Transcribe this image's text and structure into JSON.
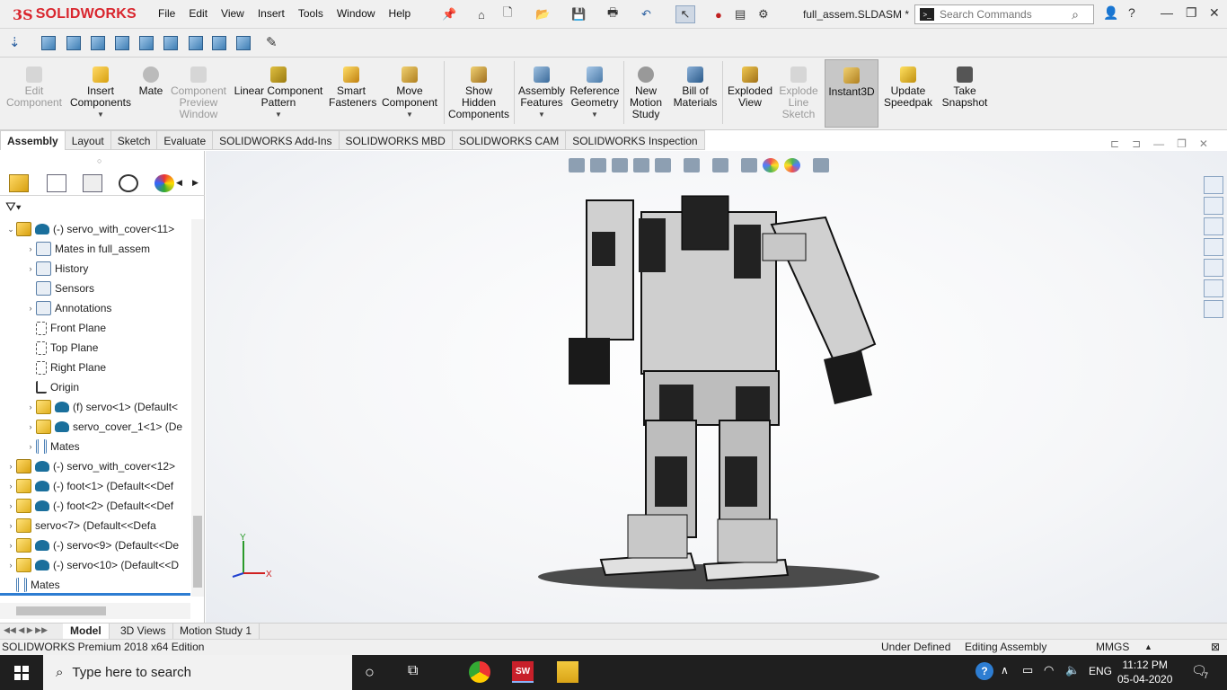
{
  "titlebar": {
    "brand": "SOLIDWORKS",
    "menu": [
      "File",
      "Edit",
      "View",
      "Insert",
      "Tools",
      "Window",
      "Help"
    ],
    "doc_title": "full_assem.SLDASM *",
    "search_placeholder": "Search Commands"
  },
  "command_manager": {
    "items": [
      {
        "label": "Edit Component",
        "enabled": false
      },
      {
        "label": "Insert Components",
        "enabled": true
      },
      {
        "label": "Mate",
        "enabled": true
      },
      {
        "label": "Component Preview Window",
        "enabled": false
      },
      {
        "label": "Linear Component Pattern",
        "enabled": true
      },
      {
        "label": "Smart Fasteners",
        "enabled": true
      },
      {
        "label": "Move Component",
        "enabled": true
      },
      {
        "label": "Show Hidden Components",
        "enabled": true
      },
      {
        "label": "Assembly Features",
        "enabled": true
      },
      {
        "label": "Reference Geometry",
        "enabled": true
      },
      {
        "label": "New Motion Study",
        "enabled": true
      },
      {
        "label": "Bill of Materials",
        "enabled": true
      },
      {
        "label": "Exploded View",
        "enabled": true
      },
      {
        "label": "Explode Line Sketch",
        "enabled": false
      },
      {
        "label": "Instant3D",
        "enabled": true,
        "active": true
      },
      {
        "label": "Update Speedpak",
        "enabled": true
      },
      {
        "label": "Take Snapshot",
        "enabled": true
      }
    ]
  },
  "tabs": [
    "Assembly",
    "Layout",
    "Sketch",
    "Evaluate",
    "SOLIDWORKS Add-Ins",
    "SOLIDWORKS MBD",
    "SOLIDWORKS CAM",
    "SOLIDWORKS Inspection"
  ],
  "tree": [
    {
      "text": "(-) servo_with_cover<11>",
      "icon": "assembly",
      "exp": "v"
    },
    {
      "text": "Mates in full_assem",
      "icon": "folder",
      "exp": ">"
    },
    {
      "text": "History",
      "icon": "folder",
      "exp": ">"
    },
    {
      "text": "Sensors",
      "icon": "folder",
      "exp": ""
    },
    {
      "text": "Annotations",
      "icon": "folder",
      "exp": ">"
    },
    {
      "text": "Front Plane",
      "icon": "plane",
      "exp": ""
    },
    {
      "text": "Top Plane",
      "icon": "plane",
      "exp": ""
    },
    {
      "text": "Right Plane",
      "icon": "plane",
      "exp": ""
    },
    {
      "text": "Origin",
      "icon": "origin",
      "exp": ""
    },
    {
      "text": "(f) servo<1> (Default<",
      "icon": "part",
      "exp": ">"
    },
    {
      "text": "servo_cover_1<1> (De",
      "icon": "part",
      "exp": ">"
    },
    {
      "text": "Mates",
      "icon": "mate",
      "exp": ">"
    },
    {
      "text": "(-) servo_with_cover<12>",
      "icon": "assembly",
      "exp": ">"
    },
    {
      "text": "(-) foot<1> (Default<<Def",
      "icon": "part",
      "exp": ">"
    },
    {
      "text": "(-) foot<2> (Default<<Def",
      "icon": "part",
      "exp": ">"
    },
    {
      "text": "servo<7> (Default<<Defa",
      "icon": "part",
      "exp": ">"
    },
    {
      "text": "(-) servo<9> (Default<<De",
      "icon": "part",
      "exp": ">"
    },
    {
      "text": "(-) servo<10> (Default<<D",
      "icon": "part",
      "exp": ">"
    },
    {
      "text": "Mates",
      "icon": "mate",
      "exp": ">"
    }
  ],
  "bottom_tabs": [
    "Model",
    "3D Views",
    "Motion Study 1"
  ],
  "status": {
    "edition": "SOLIDWORKS Premium 2018 x64 Edition",
    "state": "Under Defined",
    "mode": "Editing Assembly",
    "units": "MMGS"
  },
  "taskbar": {
    "search_placeholder": "Type here to search",
    "time": "11:12 PM",
    "date": "05-04-2020",
    "language": "ENG",
    "notifications": "7"
  },
  "triad": {
    "x": "X",
    "y": "Y"
  }
}
